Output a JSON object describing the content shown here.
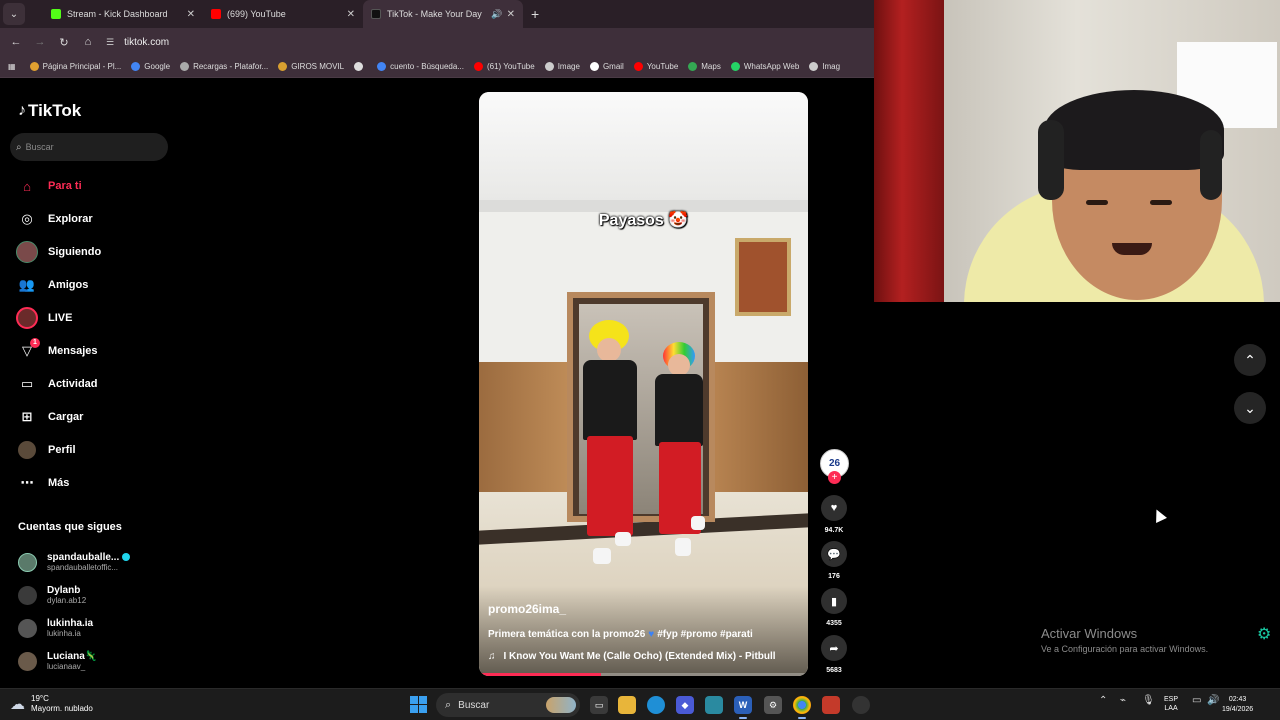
{
  "browser": {
    "tabs": [
      {
        "title": "Stream - Kick Dashboard",
        "favicon_color": "#53fc18",
        "active": false
      },
      {
        "title": "(699) YouTube",
        "favicon_color": "#ff0000",
        "active": false
      },
      {
        "title": "TikTok - Make Your Day",
        "favicon_color": "#000000",
        "active": true
      }
    ],
    "url": "tiktok.com",
    "bookmarks": [
      {
        "label": "Página Principal - Pl...",
        "color": "#e0a030"
      },
      {
        "label": "Google",
        "color": "#4285f4"
      },
      {
        "label": "Recargas - Platafor...",
        "color": "#aaaaaa"
      },
      {
        "label": "GIROS MOVIL",
        "color": "#d8a030"
      },
      {
        "label": "",
        "color": "#dddddd"
      },
      {
        "label": "cuento - Búsqueda...",
        "color": "#4285f4"
      },
      {
        "label": "(61) YouTube",
        "color": "#ff0000"
      },
      {
        "label": "Image",
        "color": "#cccccc"
      },
      {
        "label": "Gmail",
        "color": "#ffffff"
      },
      {
        "label": "YouTube",
        "color": "#ff0000"
      },
      {
        "label": "Maps",
        "color": "#34a853"
      },
      {
        "label": "WhatsApp Web",
        "color": "#25d366"
      },
      {
        "label": "Imag",
        "color": "#cccccc"
      }
    ]
  },
  "tiktok": {
    "logo": "TikTok",
    "search_placeholder": "Buscar",
    "nav": [
      {
        "label": "Para ti",
        "icon": "home-icon"
      },
      {
        "label": "Explorar",
        "icon": "compass-icon"
      },
      {
        "label": "Siguiendo",
        "icon": "following-avatar-icon"
      },
      {
        "label": "Amigos",
        "icon": "friends-icon"
      },
      {
        "label": "LIVE",
        "icon": "live-icon"
      },
      {
        "label": "Mensajes",
        "icon": "messages-icon",
        "badge": "1"
      },
      {
        "label": "Actividad",
        "icon": "activity-icon"
      },
      {
        "label": "Cargar",
        "icon": "upload-icon"
      },
      {
        "label": "Perfil",
        "icon": "profile-avatar-icon"
      },
      {
        "label": "Más",
        "icon": "more-icon"
      }
    ],
    "following_title": "Cuentas que sigues",
    "following": [
      {
        "name": "spandauballe...",
        "handle": "spandauballetoffic...",
        "verified": true,
        "color": "#5a7a6a"
      },
      {
        "name": "Dylanb",
        "handle": "dylan.ab12",
        "verified": false,
        "color": "#3a3a3a"
      },
      {
        "name": "lukinha.ia",
        "handle": "lukinha.ia",
        "verified": false,
        "color": "#555555"
      },
      {
        "name": "Luciana🦎",
        "handle": "lucianaav_",
        "verified": false,
        "color": "#6a5a4a"
      }
    ]
  },
  "video": {
    "caption_overlay": "Payasos 🤡",
    "username": "promo26ima_",
    "description_before": "Primera temática con la promo26",
    "description_after": "#fyp #promo #parati",
    "music": "I Know You Want Me (Calle Ocho) (Extended Mix) - Pitbull",
    "progress": 0.37,
    "creator_avatar_text": "26",
    "likes": "94.7K",
    "comments": "176",
    "saves": "4355",
    "shares": "5683"
  },
  "overlay": {
    "activate_title": "Activar Windows",
    "activate_sub": "Ve a Configuración para activar Windows."
  },
  "taskbar": {
    "temp": "19°C",
    "weather": "Mayorm. nublado",
    "search": "Buscar",
    "lang_top": "ESP",
    "lang_bottom": "LAA",
    "time": "02:43",
    "date": "19/4/2026"
  }
}
